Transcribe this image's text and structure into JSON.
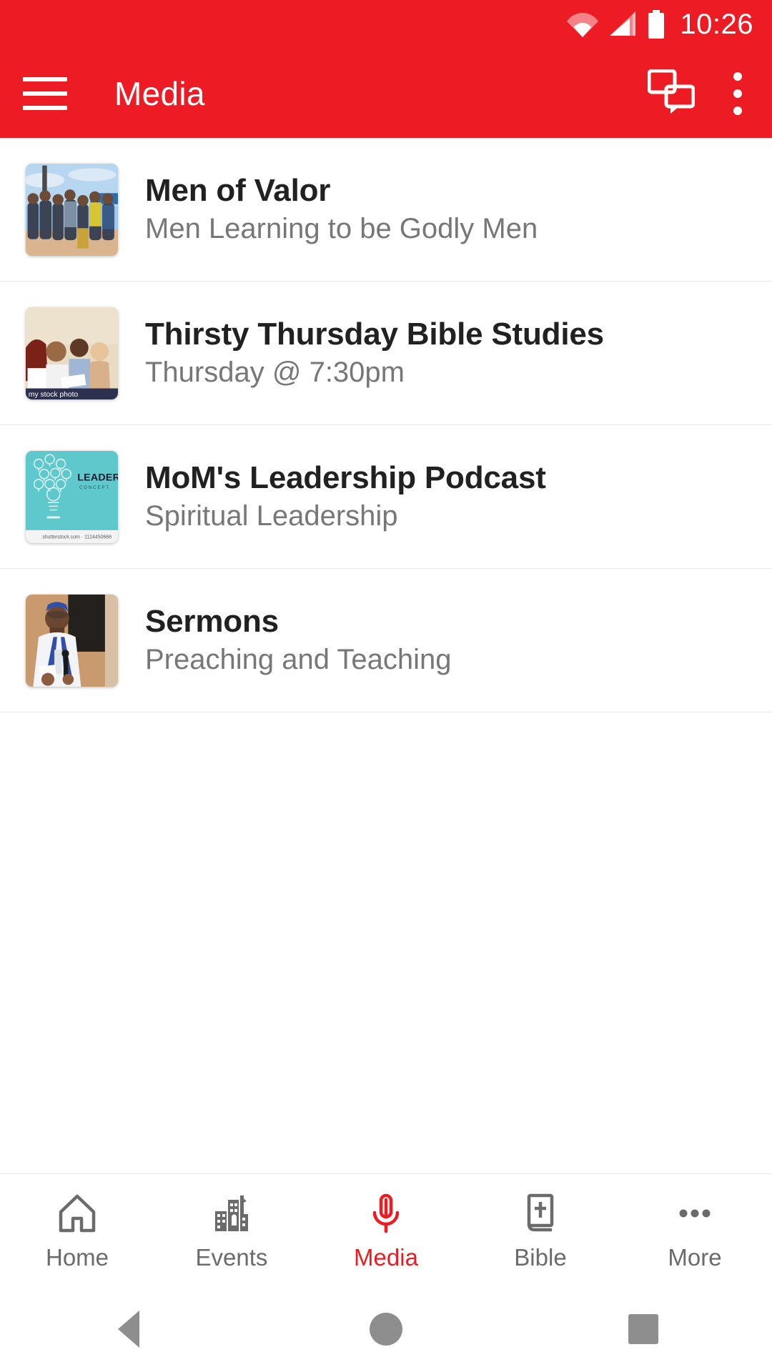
{
  "status_bar": {
    "time": "10:26",
    "icons": [
      "wifi-icon",
      "cellular-signal-icon",
      "battery-icon"
    ],
    "background_color": "#ed1c24"
  },
  "app_bar": {
    "title": "Media",
    "menu_icon": "hamburger-menu-icon",
    "chat_icon": "chat-bubbles-icon",
    "overflow_icon": "overflow-menu-icon",
    "background_color": "#ed1c24",
    "text_color": "#ffffff"
  },
  "media_list": {
    "items": [
      {
        "title": "Men of Valor",
        "subtitle": "Men Learning to be Godly Men",
        "thumbnail": "group-of-men-outdoors-photo"
      },
      {
        "title": "Thirsty Thursday Bible Studies",
        "subtitle": "Thursday @ 7:30pm",
        "thumbnail": "bible-study-group-photo",
        "thumbnail_watermark": "my stock photo"
      },
      {
        "title": "MoM's Leadership Podcast",
        "subtitle": "Spiritual Leadership",
        "thumbnail": "leadership-concept-lightbulbs-graphic",
        "thumbnail_text": "LEADERSHIP",
        "thumbnail_subtext": "CONCEPT",
        "thumbnail_watermark": "shutterstock.com · 1124450666",
        "thumbnail_color": "#5ec8cd"
      },
      {
        "title": "Sermons",
        "subtitle": "Preaching and Teaching",
        "thumbnail": "preacher-with-microphone-photo"
      }
    ]
  },
  "tab_bar": {
    "active_color": "#ed1c24",
    "inactive_color": "#6b6b6b",
    "tabs": [
      {
        "label": "Home",
        "icon": "home-icon",
        "active": false
      },
      {
        "label": "Events",
        "icon": "buildings-icon",
        "active": false
      },
      {
        "label": "Media",
        "icon": "microphone-icon",
        "active": true
      },
      {
        "label": "Bible",
        "icon": "bible-book-icon",
        "active": false
      },
      {
        "label": "More",
        "icon": "ellipsis-icon",
        "active": false
      }
    ]
  },
  "system_nav": {
    "back": "back-triangle-button",
    "home": "home-circle-button",
    "recents": "recents-square-button"
  }
}
